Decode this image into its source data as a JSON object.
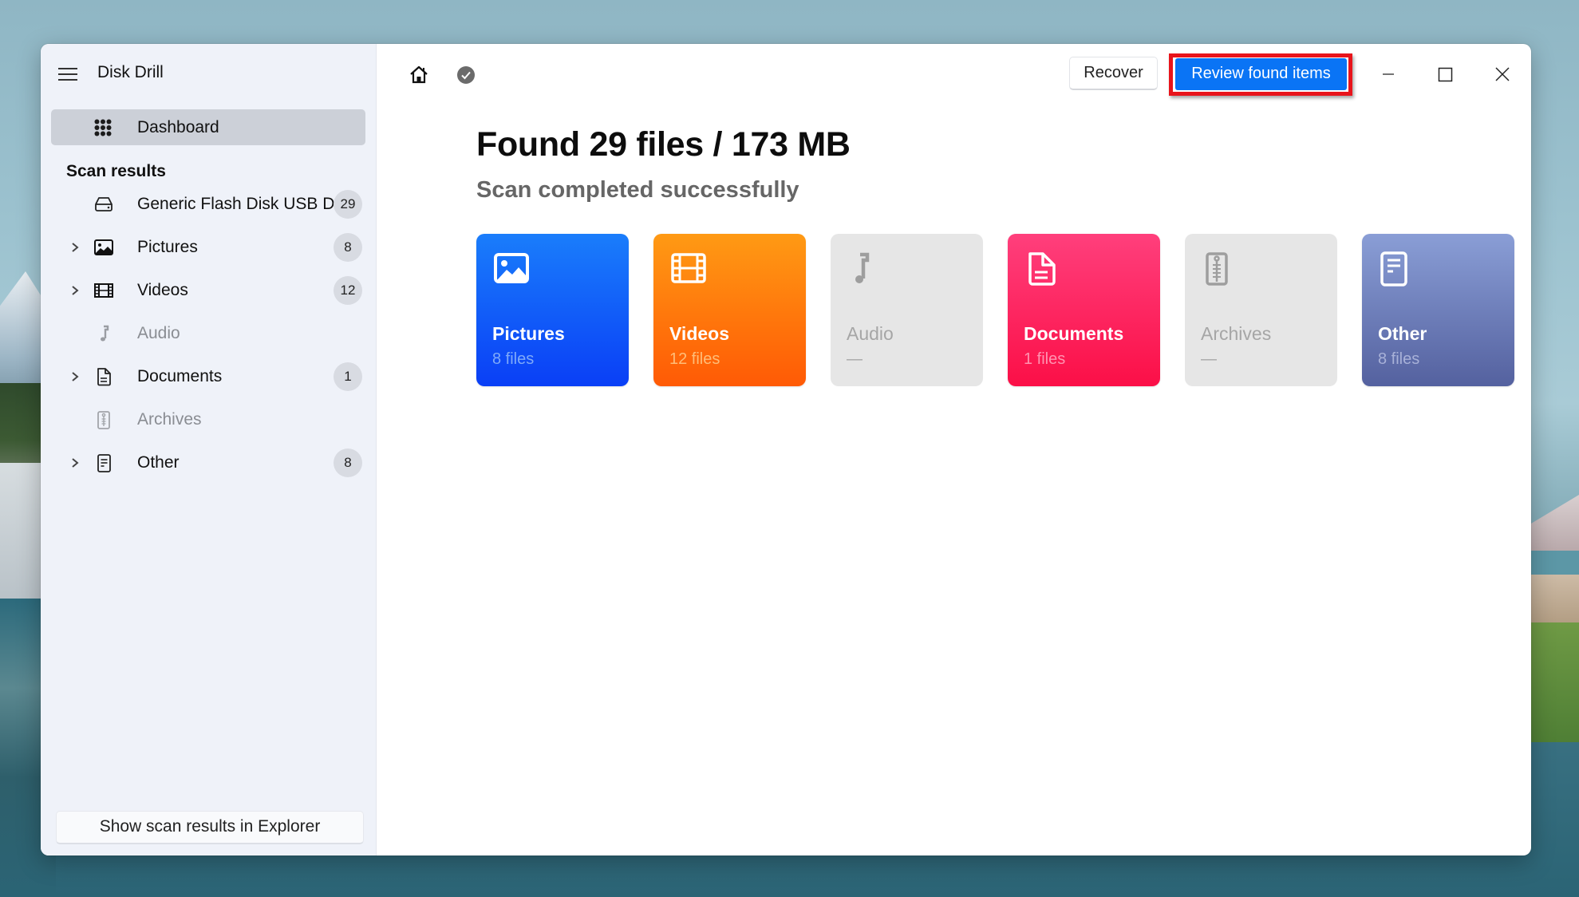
{
  "app": {
    "title": "Disk Drill"
  },
  "sidebar": {
    "dashboard_label": "Dashboard",
    "section_title": "Scan results",
    "items": [
      {
        "label": "Generic Flash Disk USB D...",
        "count": "29",
        "icon": "drive-icon",
        "expandable": false,
        "disabled": false
      },
      {
        "label": "Pictures",
        "count": "8",
        "icon": "picture-icon",
        "expandable": true,
        "disabled": false
      },
      {
        "label": "Videos",
        "count": "12",
        "icon": "film-icon",
        "expandable": true,
        "disabled": false
      },
      {
        "label": "Audio",
        "count": null,
        "icon": "music-note-icon",
        "expandable": false,
        "disabled": true
      },
      {
        "label": "Documents",
        "count": "1",
        "icon": "document-icon",
        "expandable": true,
        "disabled": false
      },
      {
        "label": "Archives",
        "count": null,
        "icon": "archive-zip-icon",
        "expandable": false,
        "disabled": true
      },
      {
        "label": "Other",
        "count": "8",
        "icon": "other-file-icon",
        "expandable": true,
        "disabled": false
      }
    ],
    "explorer_button": "Show scan results in Explorer"
  },
  "toolbar": {
    "recover_label": "Recover",
    "review_label": "Review found items",
    "review_highlight_color": "#e8141b",
    "accent_color": "#0a74f5"
  },
  "main": {
    "headline": "Found 29 files / 173 MB",
    "status": "Scan completed successfully",
    "cards": [
      {
        "title": "Pictures",
        "subtitle": "8 files",
        "icon": "picture-icon",
        "color_top": "#1a7dfb",
        "color_bottom": "#0a3ff6"
      },
      {
        "title": "Videos",
        "subtitle": "12 files",
        "icon": "film-icon",
        "color_top": "#ff9a14",
        "color_bottom": "#ff5a05"
      },
      {
        "title": "Audio",
        "subtitle": "—",
        "icon": "music-note-icon",
        "disabled": true
      },
      {
        "title": "Documents",
        "subtitle": "1 files",
        "icon": "document-icon",
        "color_top": "#ff3f7c",
        "color_bottom": "#fb0f47"
      },
      {
        "title": "Archives",
        "subtitle": "—",
        "icon": "archive-zip-icon",
        "disabled": true
      },
      {
        "title": "Other",
        "subtitle": "8 files",
        "icon": "other-file-icon",
        "color_top": "#8a9ed6",
        "color_bottom": "#54619f"
      }
    ]
  }
}
